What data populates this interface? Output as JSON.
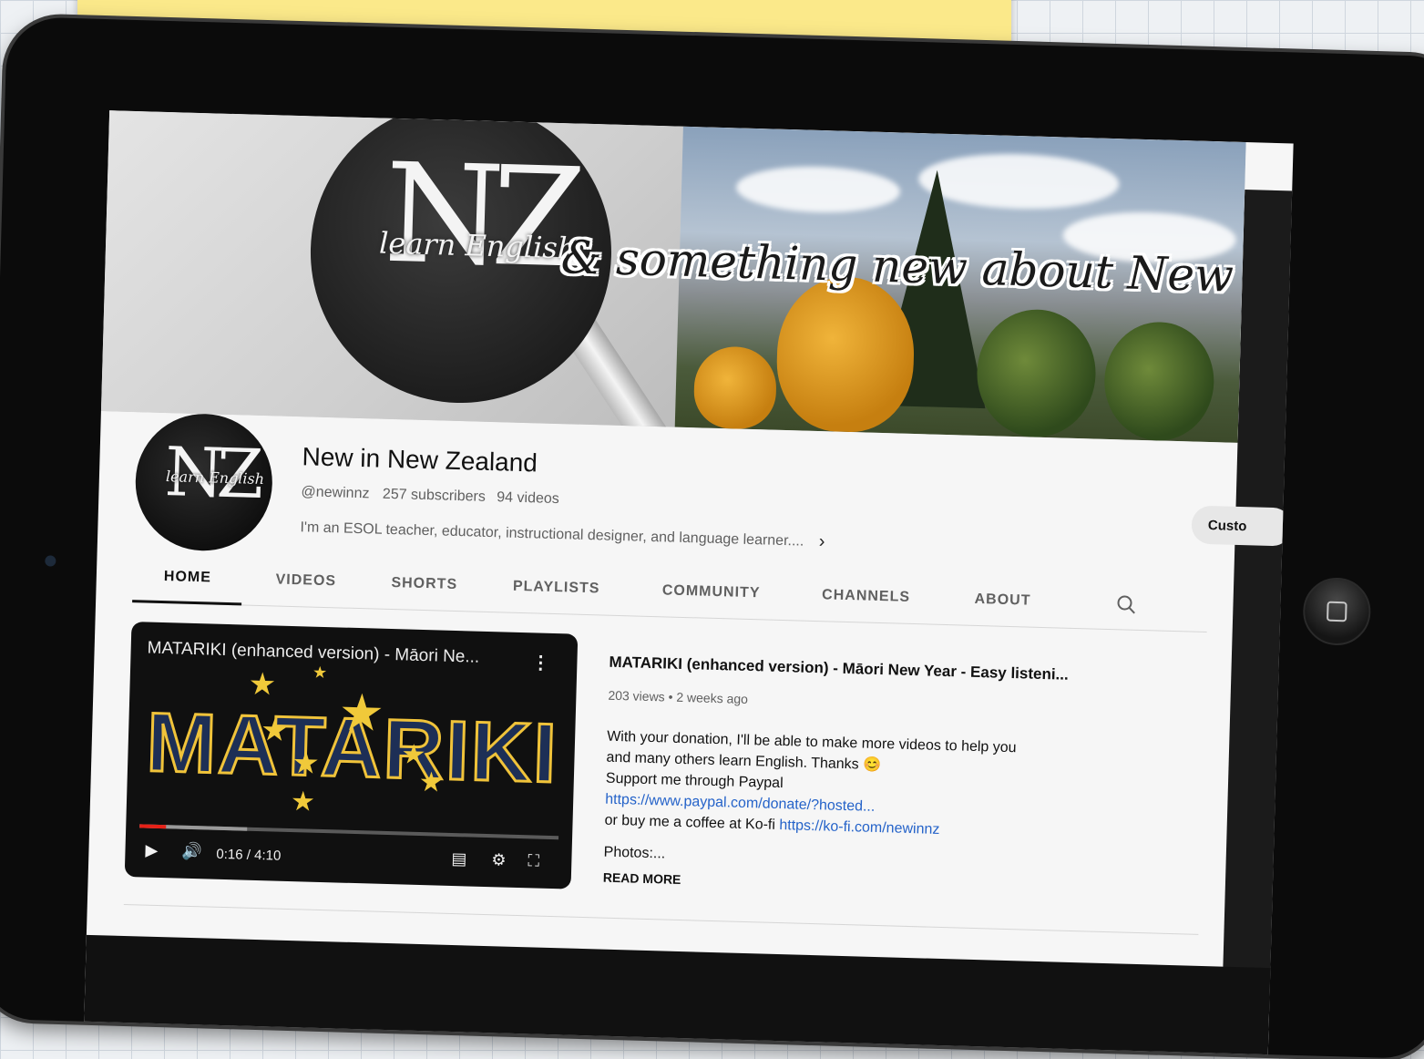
{
  "banner": {
    "logo_letters": "NZ",
    "logo_subtitle": "learn English",
    "tagline": "& something new about New Zeal"
  },
  "channel": {
    "avatar_letters": "NZ",
    "avatar_subtitle": "learn English",
    "name": "New in New Zealand",
    "handle": "@newinnz",
    "subscribers": "257 subscribers",
    "videos": "94 videos",
    "description": "I'm an ESOL teacher, educator, instructional designer, and language learner....",
    "customize_label": "Custo"
  },
  "tabs": [
    {
      "label": "HOME"
    },
    {
      "label": "VIDEOS"
    },
    {
      "label": "SHORTS"
    },
    {
      "label": "PLAYLISTS"
    },
    {
      "label": "COMMUNITY"
    },
    {
      "label": "CHANNELS"
    },
    {
      "label": "ABOUT"
    }
  ],
  "featured": {
    "player_title": "MATARIKI (enhanced version) - Māori Ne...",
    "thumbnail_text": "MATARIKI",
    "time": "0:16 / 4:10",
    "progress_fraction": 0.064,
    "title": "MATARIKI (enhanced version) - Māori New Year - Easy listeni...",
    "meta": "203 views • 2 weeks ago",
    "desc_line1": "With your donation, I'll be able to make more videos to help you",
    "desc_line2": "and many others learn English. Thanks 😊",
    "desc_line3": "Support me through Paypal",
    "paypal_link": "https://www.paypal.com/donate/?hosted...",
    "desc_line5_prefix": "or buy me a coffee at Ko-fi ",
    "kofi_link": "https://ko-fi.com/newinnz",
    "desc_line6": "Photos:...",
    "read_more": "READ MORE"
  },
  "colors": {
    "progress_red": "#e62117",
    "link_blue": "#2563c9",
    "star_gold": "#f0c93a"
  }
}
